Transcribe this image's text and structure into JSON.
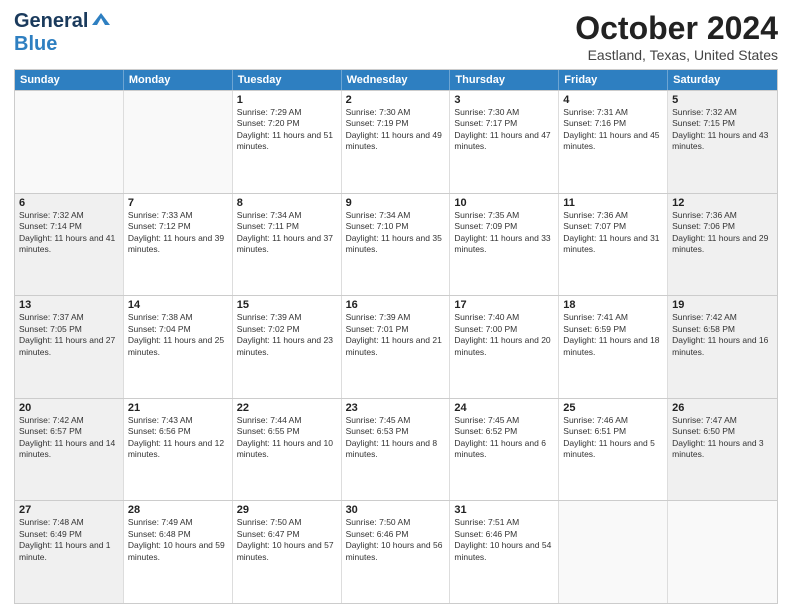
{
  "header": {
    "logo_line1": "General",
    "logo_line2": "Blue",
    "month": "October 2024",
    "location": "Eastland, Texas, United States"
  },
  "weekdays": [
    "Sunday",
    "Monday",
    "Tuesday",
    "Wednesday",
    "Thursday",
    "Friday",
    "Saturday"
  ],
  "weeks": [
    [
      {
        "day": "",
        "info": "",
        "empty": true
      },
      {
        "day": "",
        "info": "",
        "empty": true
      },
      {
        "day": "1",
        "info": "Sunrise: 7:29 AM\nSunset: 7:20 PM\nDaylight: 11 hours and 51 minutes.",
        "shaded": false
      },
      {
        "day": "2",
        "info": "Sunrise: 7:30 AM\nSunset: 7:19 PM\nDaylight: 11 hours and 49 minutes.",
        "shaded": false
      },
      {
        "day": "3",
        "info": "Sunrise: 7:30 AM\nSunset: 7:17 PM\nDaylight: 11 hours and 47 minutes.",
        "shaded": false
      },
      {
        "day": "4",
        "info": "Sunrise: 7:31 AM\nSunset: 7:16 PM\nDaylight: 11 hours and 45 minutes.",
        "shaded": false
      },
      {
        "day": "5",
        "info": "Sunrise: 7:32 AM\nSunset: 7:15 PM\nDaylight: 11 hours and 43 minutes.",
        "shaded": true
      }
    ],
    [
      {
        "day": "6",
        "info": "Sunrise: 7:32 AM\nSunset: 7:14 PM\nDaylight: 11 hours and 41 minutes.",
        "shaded": true
      },
      {
        "day": "7",
        "info": "Sunrise: 7:33 AM\nSunset: 7:12 PM\nDaylight: 11 hours and 39 minutes.",
        "shaded": false
      },
      {
        "day": "8",
        "info": "Sunrise: 7:34 AM\nSunset: 7:11 PM\nDaylight: 11 hours and 37 minutes.",
        "shaded": false
      },
      {
        "day": "9",
        "info": "Sunrise: 7:34 AM\nSunset: 7:10 PM\nDaylight: 11 hours and 35 minutes.",
        "shaded": false
      },
      {
        "day": "10",
        "info": "Sunrise: 7:35 AM\nSunset: 7:09 PM\nDaylight: 11 hours and 33 minutes.",
        "shaded": false
      },
      {
        "day": "11",
        "info": "Sunrise: 7:36 AM\nSunset: 7:07 PM\nDaylight: 11 hours and 31 minutes.",
        "shaded": false
      },
      {
        "day": "12",
        "info": "Sunrise: 7:36 AM\nSunset: 7:06 PM\nDaylight: 11 hours and 29 minutes.",
        "shaded": true
      }
    ],
    [
      {
        "day": "13",
        "info": "Sunrise: 7:37 AM\nSunset: 7:05 PM\nDaylight: 11 hours and 27 minutes.",
        "shaded": true
      },
      {
        "day": "14",
        "info": "Sunrise: 7:38 AM\nSunset: 7:04 PM\nDaylight: 11 hours and 25 minutes.",
        "shaded": false
      },
      {
        "day": "15",
        "info": "Sunrise: 7:39 AM\nSunset: 7:02 PM\nDaylight: 11 hours and 23 minutes.",
        "shaded": false
      },
      {
        "day": "16",
        "info": "Sunrise: 7:39 AM\nSunset: 7:01 PM\nDaylight: 11 hours and 21 minutes.",
        "shaded": false
      },
      {
        "day": "17",
        "info": "Sunrise: 7:40 AM\nSunset: 7:00 PM\nDaylight: 11 hours and 20 minutes.",
        "shaded": false
      },
      {
        "day": "18",
        "info": "Sunrise: 7:41 AM\nSunset: 6:59 PM\nDaylight: 11 hours and 18 minutes.",
        "shaded": false
      },
      {
        "day": "19",
        "info": "Sunrise: 7:42 AM\nSunset: 6:58 PM\nDaylight: 11 hours and 16 minutes.",
        "shaded": true
      }
    ],
    [
      {
        "day": "20",
        "info": "Sunrise: 7:42 AM\nSunset: 6:57 PM\nDaylight: 11 hours and 14 minutes.",
        "shaded": true
      },
      {
        "day": "21",
        "info": "Sunrise: 7:43 AM\nSunset: 6:56 PM\nDaylight: 11 hours and 12 minutes.",
        "shaded": false
      },
      {
        "day": "22",
        "info": "Sunrise: 7:44 AM\nSunset: 6:55 PM\nDaylight: 11 hours and 10 minutes.",
        "shaded": false
      },
      {
        "day": "23",
        "info": "Sunrise: 7:45 AM\nSunset: 6:53 PM\nDaylight: 11 hours and 8 minutes.",
        "shaded": false
      },
      {
        "day": "24",
        "info": "Sunrise: 7:45 AM\nSunset: 6:52 PM\nDaylight: 11 hours and 6 minutes.",
        "shaded": false
      },
      {
        "day": "25",
        "info": "Sunrise: 7:46 AM\nSunset: 6:51 PM\nDaylight: 11 hours and 5 minutes.",
        "shaded": false
      },
      {
        "day": "26",
        "info": "Sunrise: 7:47 AM\nSunset: 6:50 PM\nDaylight: 11 hours and 3 minutes.",
        "shaded": true
      }
    ],
    [
      {
        "day": "27",
        "info": "Sunrise: 7:48 AM\nSunset: 6:49 PM\nDaylight: 11 hours and 1 minute.",
        "shaded": true
      },
      {
        "day": "28",
        "info": "Sunrise: 7:49 AM\nSunset: 6:48 PM\nDaylight: 10 hours and 59 minutes.",
        "shaded": false
      },
      {
        "day": "29",
        "info": "Sunrise: 7:50 AM\nSunset: 6:47 PM\nDaylight: 10 hours and 57 minutes.",
        "shaded": false
      },
      {
        "day": "30",
        "info": "Sunrise: 7:50 AM\nSunset: 6:46 PM\nDaylight: 10 hours and 56 minutes.",
        "shaded": false
      },
      {
        "day": "31",
        "info": "Sunrise: 7:51 AM\nSunset: 6:46 PM\nDaylight: 10 hours and 54 minutes.",
        "shaded": false
      },
      {
        "day": "",
        "info": "",
        "empty": true
      },
      {
        "day": "",
        "info": "",
        "empty": true
      }
    ]
  ]
}
